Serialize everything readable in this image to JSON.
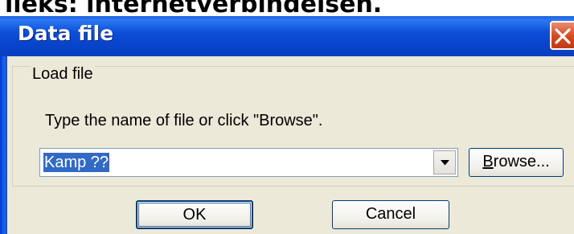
{
  "background_text": "lieks: internetverbindelsen.",
  "dialog": {
    "title": "Data file",
    "group": {
      "legend": "Load file",
      "instruction": "Type the name of file or click \"Browse\".",
      "file_combo": {
        "value": "Kamp ??"
      }
    },
    "buttons": {
      "browse_label_first": "B",
      "browse_label_rest": "rowse...",
      "ok_label": "OK",
      "cancel_label": "Cancel"
    }
  },
  "icons": [
    "close-icon",
    "dropdown-arrow-icon"
  ],
  "colors": {
    "titlebar": "#0a3ec0",
    "client_bg": "#ece9d8",
    "close_button": "#d2491e",
    "selection": "#316ac5"
  }
}
